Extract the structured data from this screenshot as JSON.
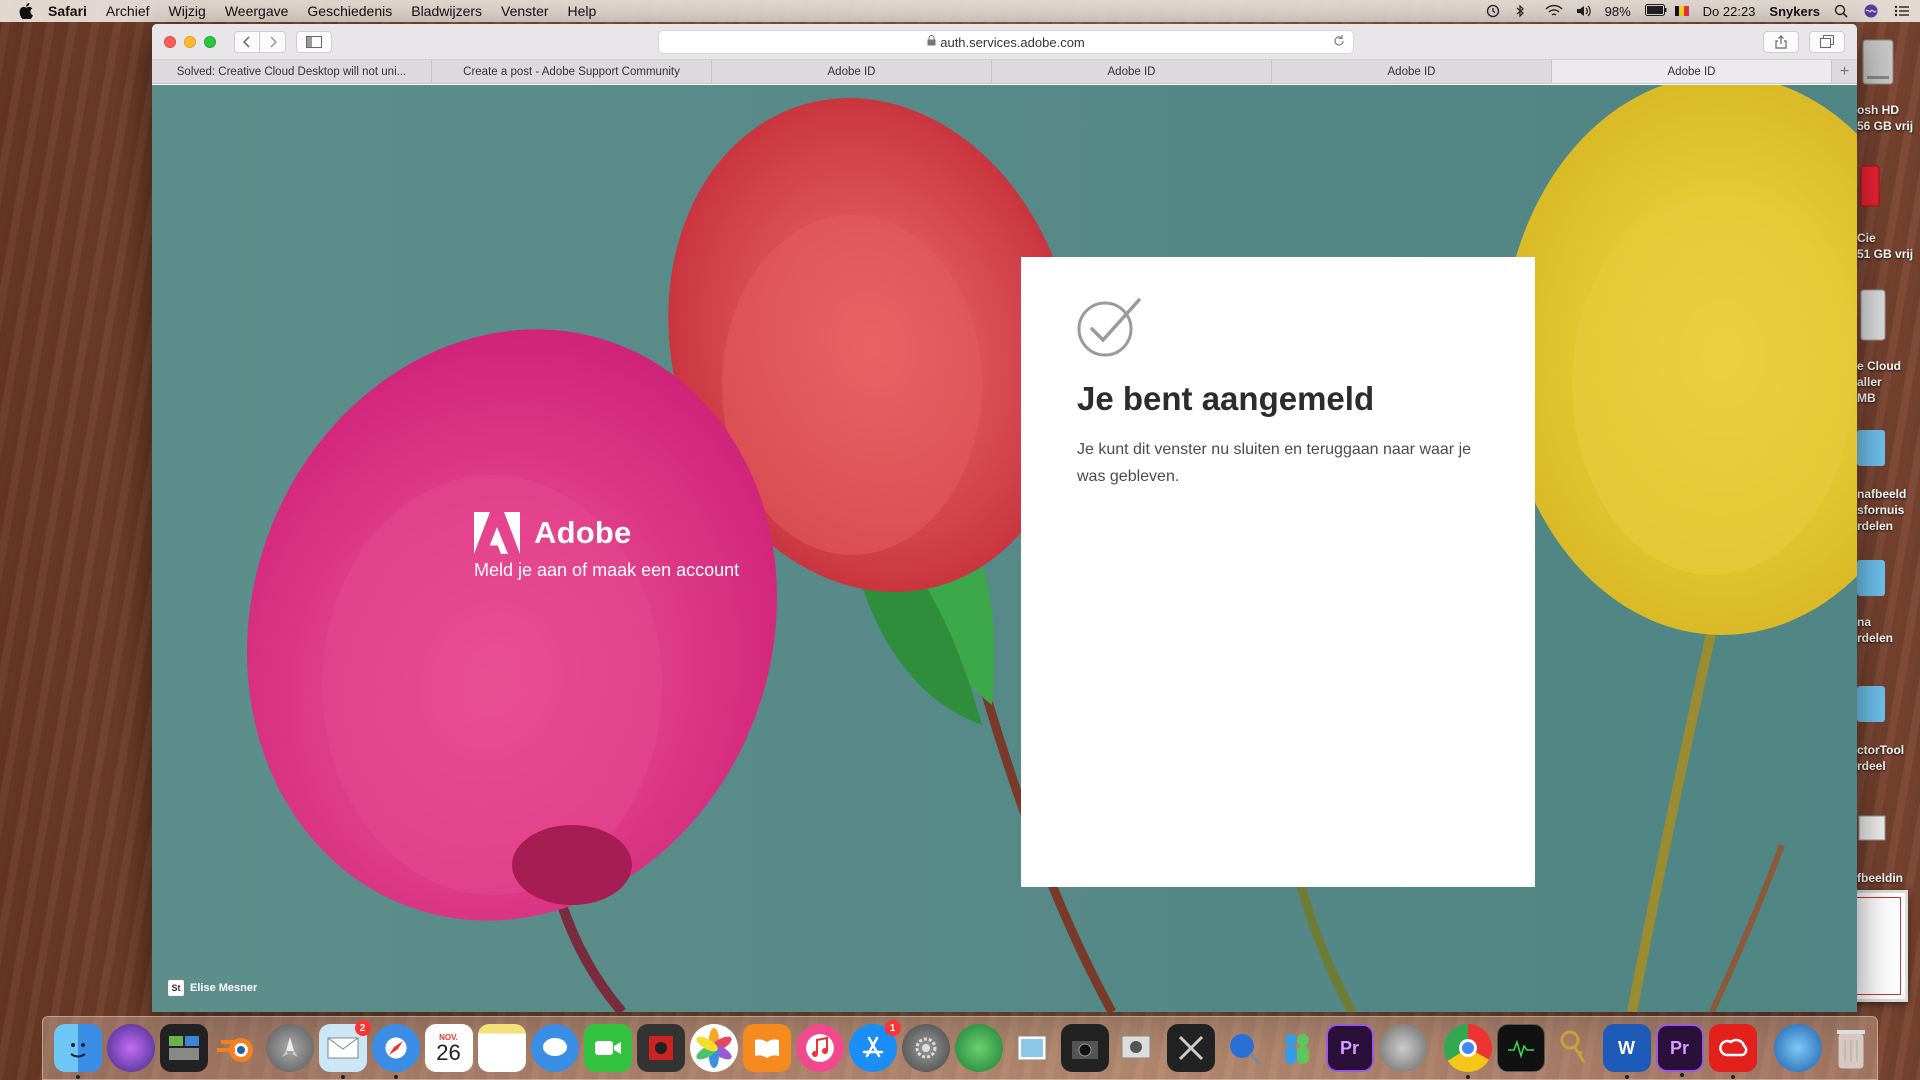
{
  "menubar": {
    "items": [
      "Safari",
      "Archief",
      "Wijzig",
      "Weergave",
      "Geschiedenis",
      "Bladwijzers",
      "Venster",
      "Help"
    ],
    "battery": "98%",
    "clock": "Do 22:23",
    "user": "Snykers"
  },
  "browser": {
    "url": "auth.services.adobe.com",
    "tabs": [
      "Solved: Creative Cloud Desktop will not uni...",
      "Create a post - Adobe Support Community",
      "Adobe ID",
      "Adobe ID",
      "Adobe ID",
      "Adobe ID"
    ],
    "active_tab_index": 5
  },
  "page": {
    "brand_name": "Adobe",
    "brand_tagline": "Meld je aan of maak een account",
    "photo_credit": "Elise Mesner",
    "photo_credit_badge": "St",
    "card": {
      "title": "Je bent aangemeld",
      "message": "Je kunt dit venster nu sluiten en teruggaan naar waar je was gebleven."
    }
  },
  "desktop": {
    "labels": [
      {
        "line1": "osh HD",
        "line2": "56 GB vrij"
      },
      {
        "line1": "Cie",
        "line2": "51 GB vrij"
      },
      {
        "line1": "e Cloud",
        "line2": "aller",
        "line3": "MB"
      },
      {
        "line1": "nafbeeld",
        "line2": "sfornuis",
        "line3": "rdelen"
      },
      {
        "line1": "na",
        "line2": "rdelen"
      },
      {
        "line1": "ctorTool",
        "line2": "rdeel"
      },
      {
        "line1": "fbeeldin"
      }
    ]
  },
  "dock": {
    "badges": {
      "mail": "2",
      "appstore": "1"
    },
    "calendar_month": "NOV.",
    "calendar_day": "26"
  },
  "colors": {
    "accent_adobe": "#fa0f00",
    "page_bg": "#5e8f8c"
  }
}
